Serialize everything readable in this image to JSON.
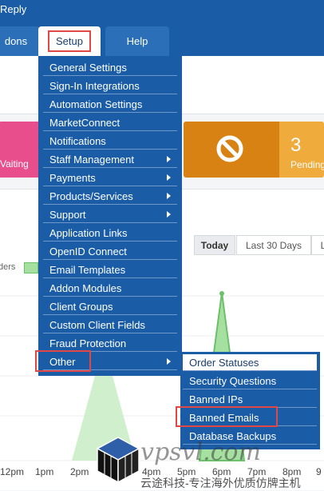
{
  "topbar": {
    "reply_label": "Reply",
    "tabs": {
      "addons": "dons",
      "setup": "Setup",
      "help": "Help"
    }
  },
  "stats": {
    "pink_label": "Vaiting",
    "pending_count": "3",
    "pending_label": "Pending"
  },
  "chart": {
    "period_buttons": [
      "Today",
      "Last 30 Days",
      "L"
    ],
    "legend_label": "ders",
    "x_axis_labels": [
      "12pm",
      "1pm",
      "2pm",
      "4pm",
      "5pm",
      "6pm",
      "7pm",
      "8pm",
      "9"
    ]
  },
  "setup_menu": {
    "items": [
      {
        "label": "General Settings",
        "submenu": false
      },
      {
        "label": "Sign-In Integrations",
        "submenu": false
      },
      {
        "label": "Automation Settings",
        "submenu": false
      },
      {
        "label": "MarketConnect",
        "submenu": false
      },
      {
        "label": "Notifications",
        "submenu": false
      },
      {
        "label": "Staff Management",
        "submenu": true
      },
      {
        "label": "Payments",
        "submenu": true
      },
      {
        "label": "Products/Services",
        "submenu": true
      },
      {
        "label": "Support",
        "submenu": true
      },
      {
        "label": "Application Links",
        "submenu": false
      },
      {
        "label": "OpenID Connect",
        "submenu": false
      },
      {
        "label": "Email Templates",
        "submenu": false
      },
      {
        "label": "Addon Modules",
        "submenu": false
      },
      {
        "label": "Client Groups",
        "submenu": false
      },
      {
        "label": "Custom Client Fields",
        "submenu": false
      },
      {
        "label": "Fraud Protection",
        "submenu": false
      },
      {
        "label": "Other",
        "submenu": true
      }
    ]
  },
  "other_submenu": {
    "items": [
      "Order Statuses",
      "Security Questions",
      "Banned IPs",
      "Banned Emails",
      "Database Backups"
    ]
  },
  "watermark": {
    "site": "vpsvl.com",
    "tagline": "云途科技-专注海外优质仿牌主机"
  },
  "colors": {
    "nav_blue": "#1a5da6",
    "highlight_red": "#e04848",
    "pink": "#e94e8c",
    "orange": "#d98214",
    "chart_green": "#a6e0a0"
  }
}
